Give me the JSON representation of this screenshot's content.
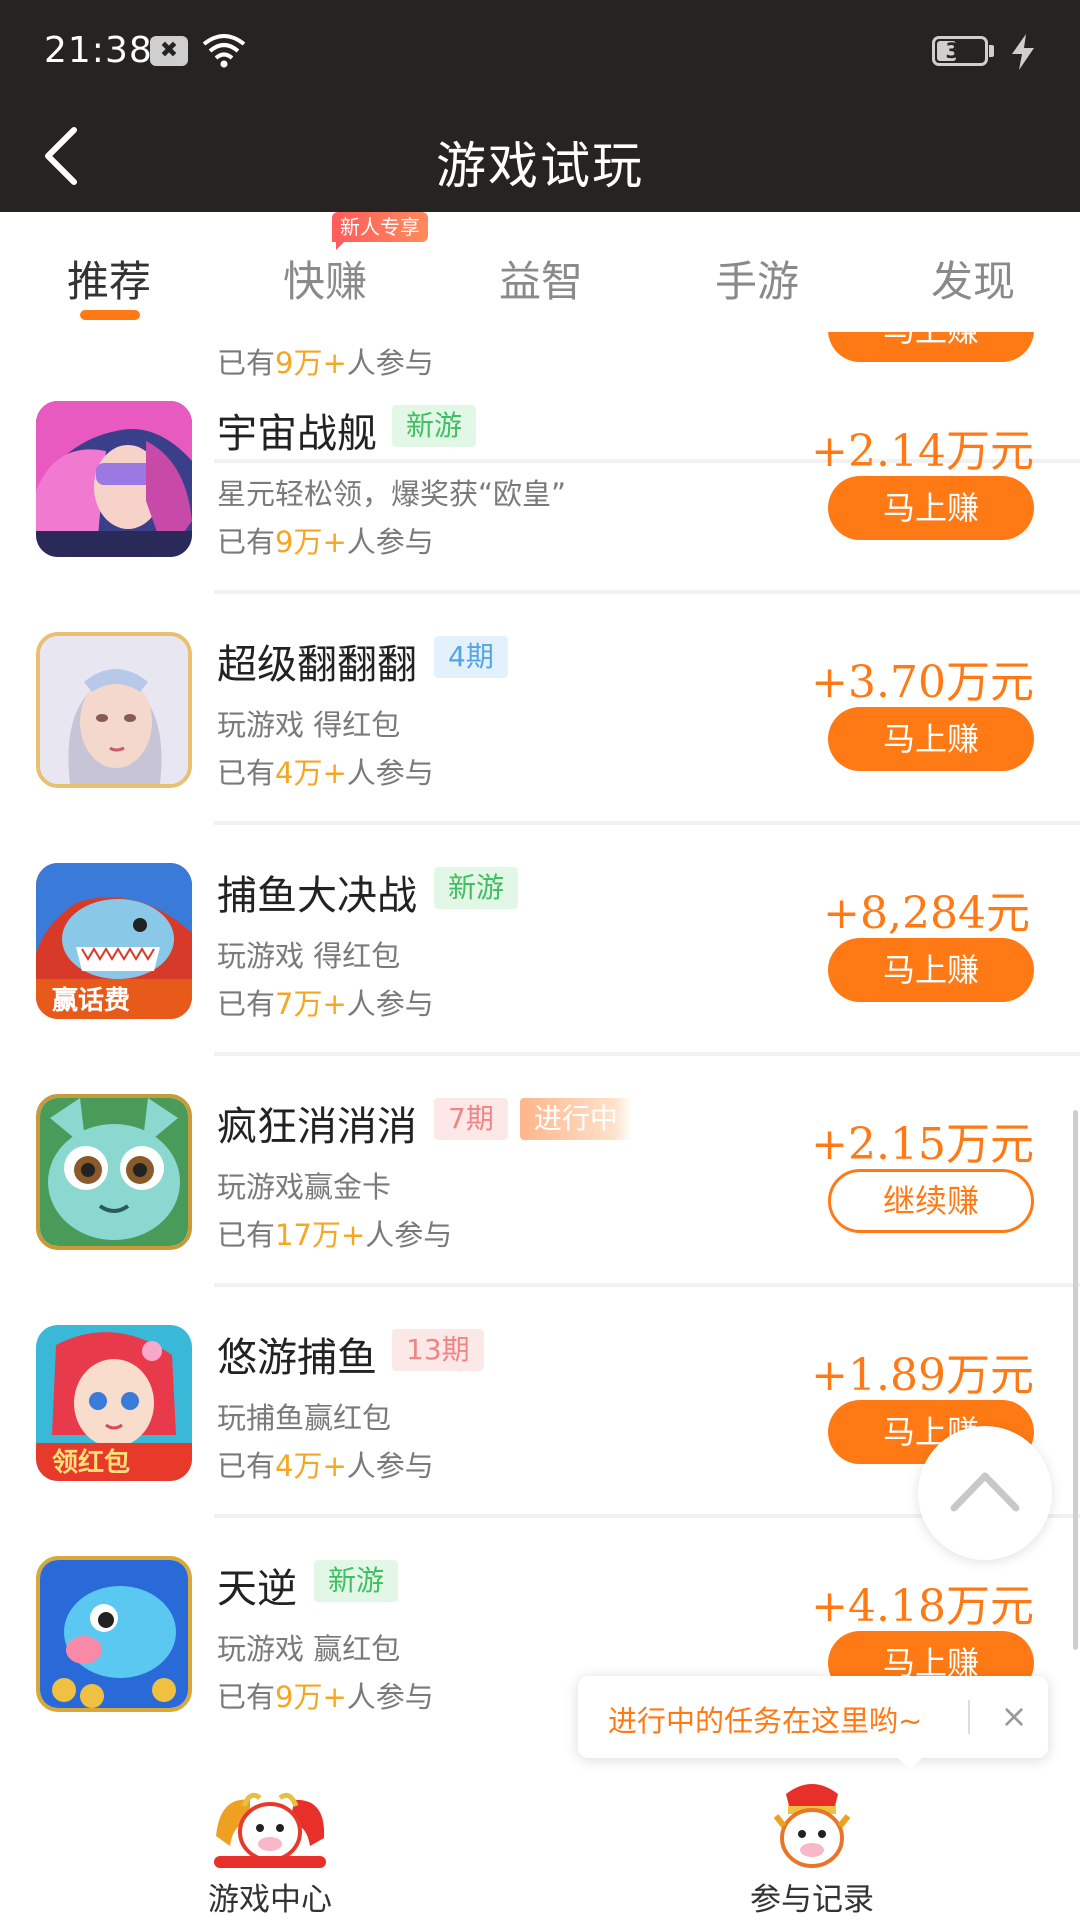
{
  "status_bar": {
    "time": "21:38",
    "battery": "39"
  },
  "header": {
    "title": "游戏试玩"
  },
  "tabs": [
    {
      "label": "推荐",
      "active": true
    },
    {
      "label": "快赚",
      "badge": "新人专享"
    },
    {
      "label": "益智"
    },
    {
      "label": "手游"
    },
    {
      "label": "发现"
    }
  ],
  "games": [
    {
      "name": "",
      "desc": "",
      "joined_prefix": "已有",
      "joined_num": "9万+",
      "joined_suffix": "人参与",
      "reward": "",
      "button": "马上赚"
    },
    {
      "name": "宇宙战舰",
      "tags": [
        "新游"
      ],
      "desc": "星元轻松领，爆奖获“欧皇”",
      "joined_prefix": "已有",
      "joined_num": "9万+",
      "joined_suffix": "人参与",
      "reward": "+2.14万元",
      "button": "马上赚"
    },
    {
      "name": "超级翻翻翻",
      "tags": [
        "4期"
      ],
      "desc": "玩游戏 得红包",
      "joined_prefix": "已有",
      "joined_num": "4万+",
      "joined_suffix": "人参与",
      "reward": "+3.70万元",
      "button": "马上赚"
    },
    {
      "name": "捕鱼大决战",
      "tags": [
        "新游"
      ],
      "desc": "玩游戏 得红包",
      "joined_prefix": "已有",
      "joined_num": "7万+",
      "joined_suffix": "人参与",
      "reward": "+8,284元",
      "button": "马上赚",
      "thumb_text": "赢话费"
    },
    {
      "name": "疯狂消消消",
      "tags": [
        "7期",
        "进行中"
      ],
      "desc": "玩游戏赢金卡",
      "joined_prefix": "已有",
      "joined_num": "17万+",
      "joined_suffix": "人参与",
      "reward": "+2.15万元",
      "button": "继续赚"
    },
    {
      "name": "悠游捕鱼",
      "tags": [
        "13期"
      ],
      "desc": "玩捕鱼赢红包",
      "joined_prefix": "已有",
      "joined_num": "4万+",
      "joined_suffix": "人参与",
      "reward": "+1.89万元",
      "button": "马上赚",
      "thumb_text": "领红包"
    },
    {
      "name": "天逆",
      "tags": [
        "新游"
      ],
      "desc": "玩游戏 赢红包",
      "joined_prefix": "已有",
      "joined_num": "9万+",
      "joined_suffix": "人参与",
      "reward": "+4.18万元",
      "button": "马上赚"
    }
  ],
  "toast": {
    "message": "进行中的任务在这里哟~",
    "close": "×"
  },
  "bottom_nav": [
    {
      "label": "游戏中心",
      "icon": "game-center-icon"
    },
    {
      "label": "参与记录",
      "icon": "records-icon"
    }
  ],
  "colors": {
    "accent": "#ff7a14",
    "header_bg": "#272320"
  }
}
